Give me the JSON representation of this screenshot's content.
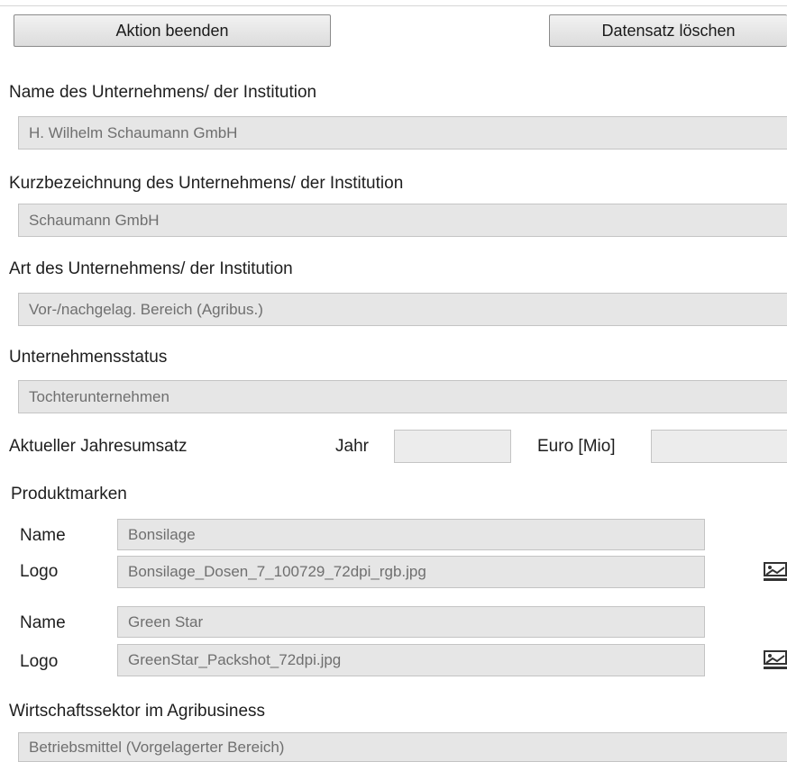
{
  "toolbar": {
    "end_action_label": "Aktion beenden",
    "delete_record_label": "Datensatz löschen"
  },
  "company": {
    "name_label": "Name des Unternehmens/ der Institution",
    "name_value": "H. Wilhelm Schaumann GmbH",
    "short_name_label": "Kurzbezeichnung des Unternehmens/ der Institution",
    "short_name_value": "Schaumann GmbH",
    "type_label": "Art des Unternehmens/ der Institution",
    "type_value": "Vor-/nachgelag. Bereich (Agribus.)",
    "status_label": "Unternehmensstatus",
    "status_value": "Tochterunternehmen"
  },
  "revenue": {
    "label": "Aktueller Jahresumsatz",
    "year_label": "Jahr",
    "year_value": "",
    "euro_label": "Euro [Mio]",
    "euro_value": ""
  },
  "brands": {
    "section_label": "Produktmarken",
    "items": [
      {
        "name_label": "Name",
        "name_value": "Bonsilage",
        "logo_label": "Logo",
        "logo_value": "Bonsilage_Dosen_7_100729_72dpi_rgb.jpg",
        "logo_icon": "image-icon"
      },
      {
        "name_label": "Name",
        "name_value": "Green Star",
        "logo_label": "Logo",
        "logo_value": "GreenStar_Packshot_72dpi.jpg",
        "logo_icon": "image-icon"
      }
    ]
  },
  "sector": {
    "label": "Wirtschaftssektor im Agribusiness",
    "value": "Betriebsmittel (Vorgelagerter Bereich)"
  }
}
